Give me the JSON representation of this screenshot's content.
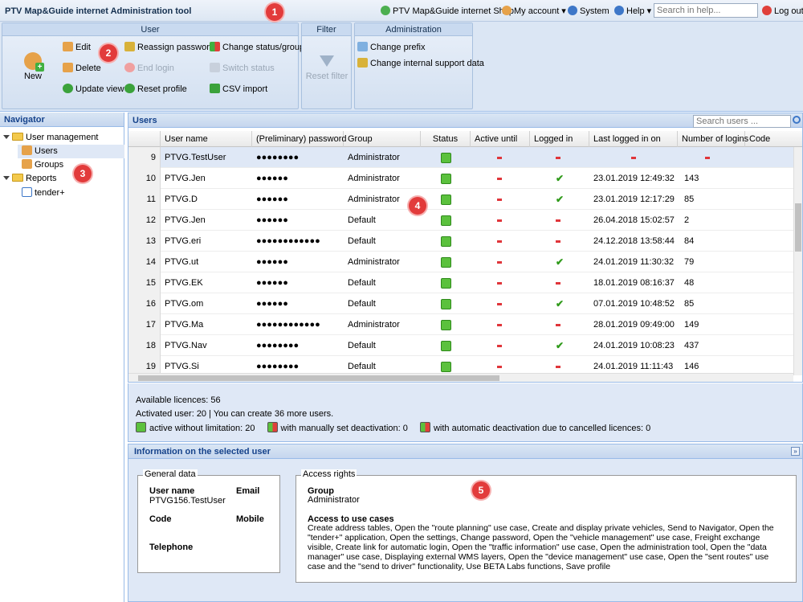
{
  "app": {
    "title": "PTV Map&Guide internet Administration tool"
  },
  "topbar": {
    "shop": "PTV Map&Guide internet Shop",
    "account": "My account ▾",
    "system": "System",
    "help": "Help ▾",
    "search_placeholder": "Search in help...",
    "logout": "Log out"
  },
  "badges": [
    "1",
    "2",
    "3",
    "4",
    "5"
  ],
  "ribbon": {
    "user_group": "User",
    "filter_group": "Filter",
    "admin_group": "Administration",
    "new": "New",
    "edit": "Edit",
    "delete": "Delete",
    "update_view": "Update view",
    "reassign_password": "Reassign password",
    "end_login": "End login",
    "reset_profile": "Reset profile",
    "change_status_group": "Change status/group",
    "switch_status": "Switch status",
    "csv_import": "CSV import",
    "reset_filter": "Reset filter",
    "change_prefix": "Change prefix",
    "change_support": "Change internal support data"
  },
  "navigator": {
    "title": "Navigator",
    "user_management": "User management",
    "users": "Users",
    "groups": "Groups",
    "reports": "Reports",
    "tender": "tender+"
  },
  "users": {
    "title": "Users",
    "search_placeholder": "Search users ...",
    "columns": [
      "User name",
      "(Preliminary) password",
      "Group",
      "Status",
      "Active until",
      "Logged in",
      "Last logged in on",
      "Number of logins",
      "Code"
    ],
    "rows": [
      {
        "n": "9",
        "name": "PTVG.TestUser",
        "pw": "●●●●●●●●",
        "group": "Administrator",
        "logged": false,
        "last": "",
        "logins": ""
      },
      {
        "n": "10",
        "name": "PTVG.Jen",
        "pw": "●●●●●●",
        "group": "Administrator",
        "logged": true,
        "last": "23.01.2019 12:49:32",
        "logins": "143"
      },
      {
        "n": "11",
        "name": "PTVG.D",
        "pw": "●●●●●●",
        "group": "Administrator",
        "logged": true,
        "last": "23.01.2019 12:17:29",
        "logins": "85"
      },
      {
        "n": "12",
        "name": "PTVG.Jen",
        "pw": "●●●●●●",
        "group": "Default",
        "logged": false,
        "last": "26.04.2018 15:02:57",
        "logins": "2"
      },
      {
        "n": "13",
        "name": "PTVG.eri",
        "pw": "●●●●●●●●●●●●",
        "group": "Default",
        "logged": false,
        "last": "24.12.2018 13:58:44",
        "logins": "84"
      },
      {
        "n": "14",
        "name": "PTVG.ut",
        "pw": "●●●●●●",
        "group": "Administrator",
        "logged": true,
        "last": "24.01.2019 11:30:32",
        "logins": "79"
      },
      {
        "n": "15",
        "name": "PTVG.EK",
        "pw": "●●●●●●",
        "group": "Default",
        "logged": false,
        "last": "18.01.2019 08:16:37",
        "logins": "48"
      },
      {
        "n": "16",
        "name": "PTVG.om",
        "pw": "●●●●●●",
        "group": "Default",
        "logged": true,
        "last": "07.01.2019 10:48:52",
        "logins": "85"
      },
      {
        "n": "17",
        "name": "PTVG.Ma",
        "pw": "●●●●●●●●●●●●",
        "group": "Administrator",
        "logged": false,
        "last": "28.01.2019 09:49:00",
        "logins": "149"
      },
      {
        "n": "18",
        "name": "PTVG.Nav",
        "pw": "●●●●●●●●",
        "group": "Default",
        "logged": true,
        "last": "24.01.2019 10:08:23",
        "logins": "437"
      },
      {
        "n": "19",
        "name": "PTVG.Si",
        "pw": "●●●●●●●●",
        "group": "Default",
        "logged": false,
        "last": "24.01.2019 11:11:43",
        "logins": "146"
      }
    ]
  },
  "licences": {
    "available": "Available licences: 56",
    "activated": "Activated user: 20 | You can create 36 more users.",
    "legend_active": "active without limitation: 20",
    "legend_manual": "with manually set deactivation: 0",
    "legend_auto": "with automatic deactivation due to cancelled licences: 0"
  },
  "info": {
    "title": "Information on the selected user",
    "general_legend": "General data",
    "user_name_label": "User name",
    "user_name_value": "PTVG156.TestUser",
    "email_label": "Email",
    "code_label": "Code",
    "mobile_label": "Mobile",
    "telephone_label": "Telephone",
    "access_legend": "Access rights",
    "group_label": "Group",
    "group_value": "Administrator",
    "use_cases_label": "Access to use cases",
    "use_cases_text": "Create address tables, Open the \"route planning\" use case, Create and display private vehicles, Send to Navigator, Open the \"tender+\" application, Open the settings, Change password, Open the \"vehicle management\" use case, Freight exchange visible, Create link for automatic login, Open the \"traffic information\" use case, Open the administration tool, Open the \"data manager\" use case, Displaying external WMS layers, Open the \"device management\" use case, Open the \"sent routes\" use case and the \"send to driver\" functionality, Use BETA Labs functions, Save profile"
  }
}
